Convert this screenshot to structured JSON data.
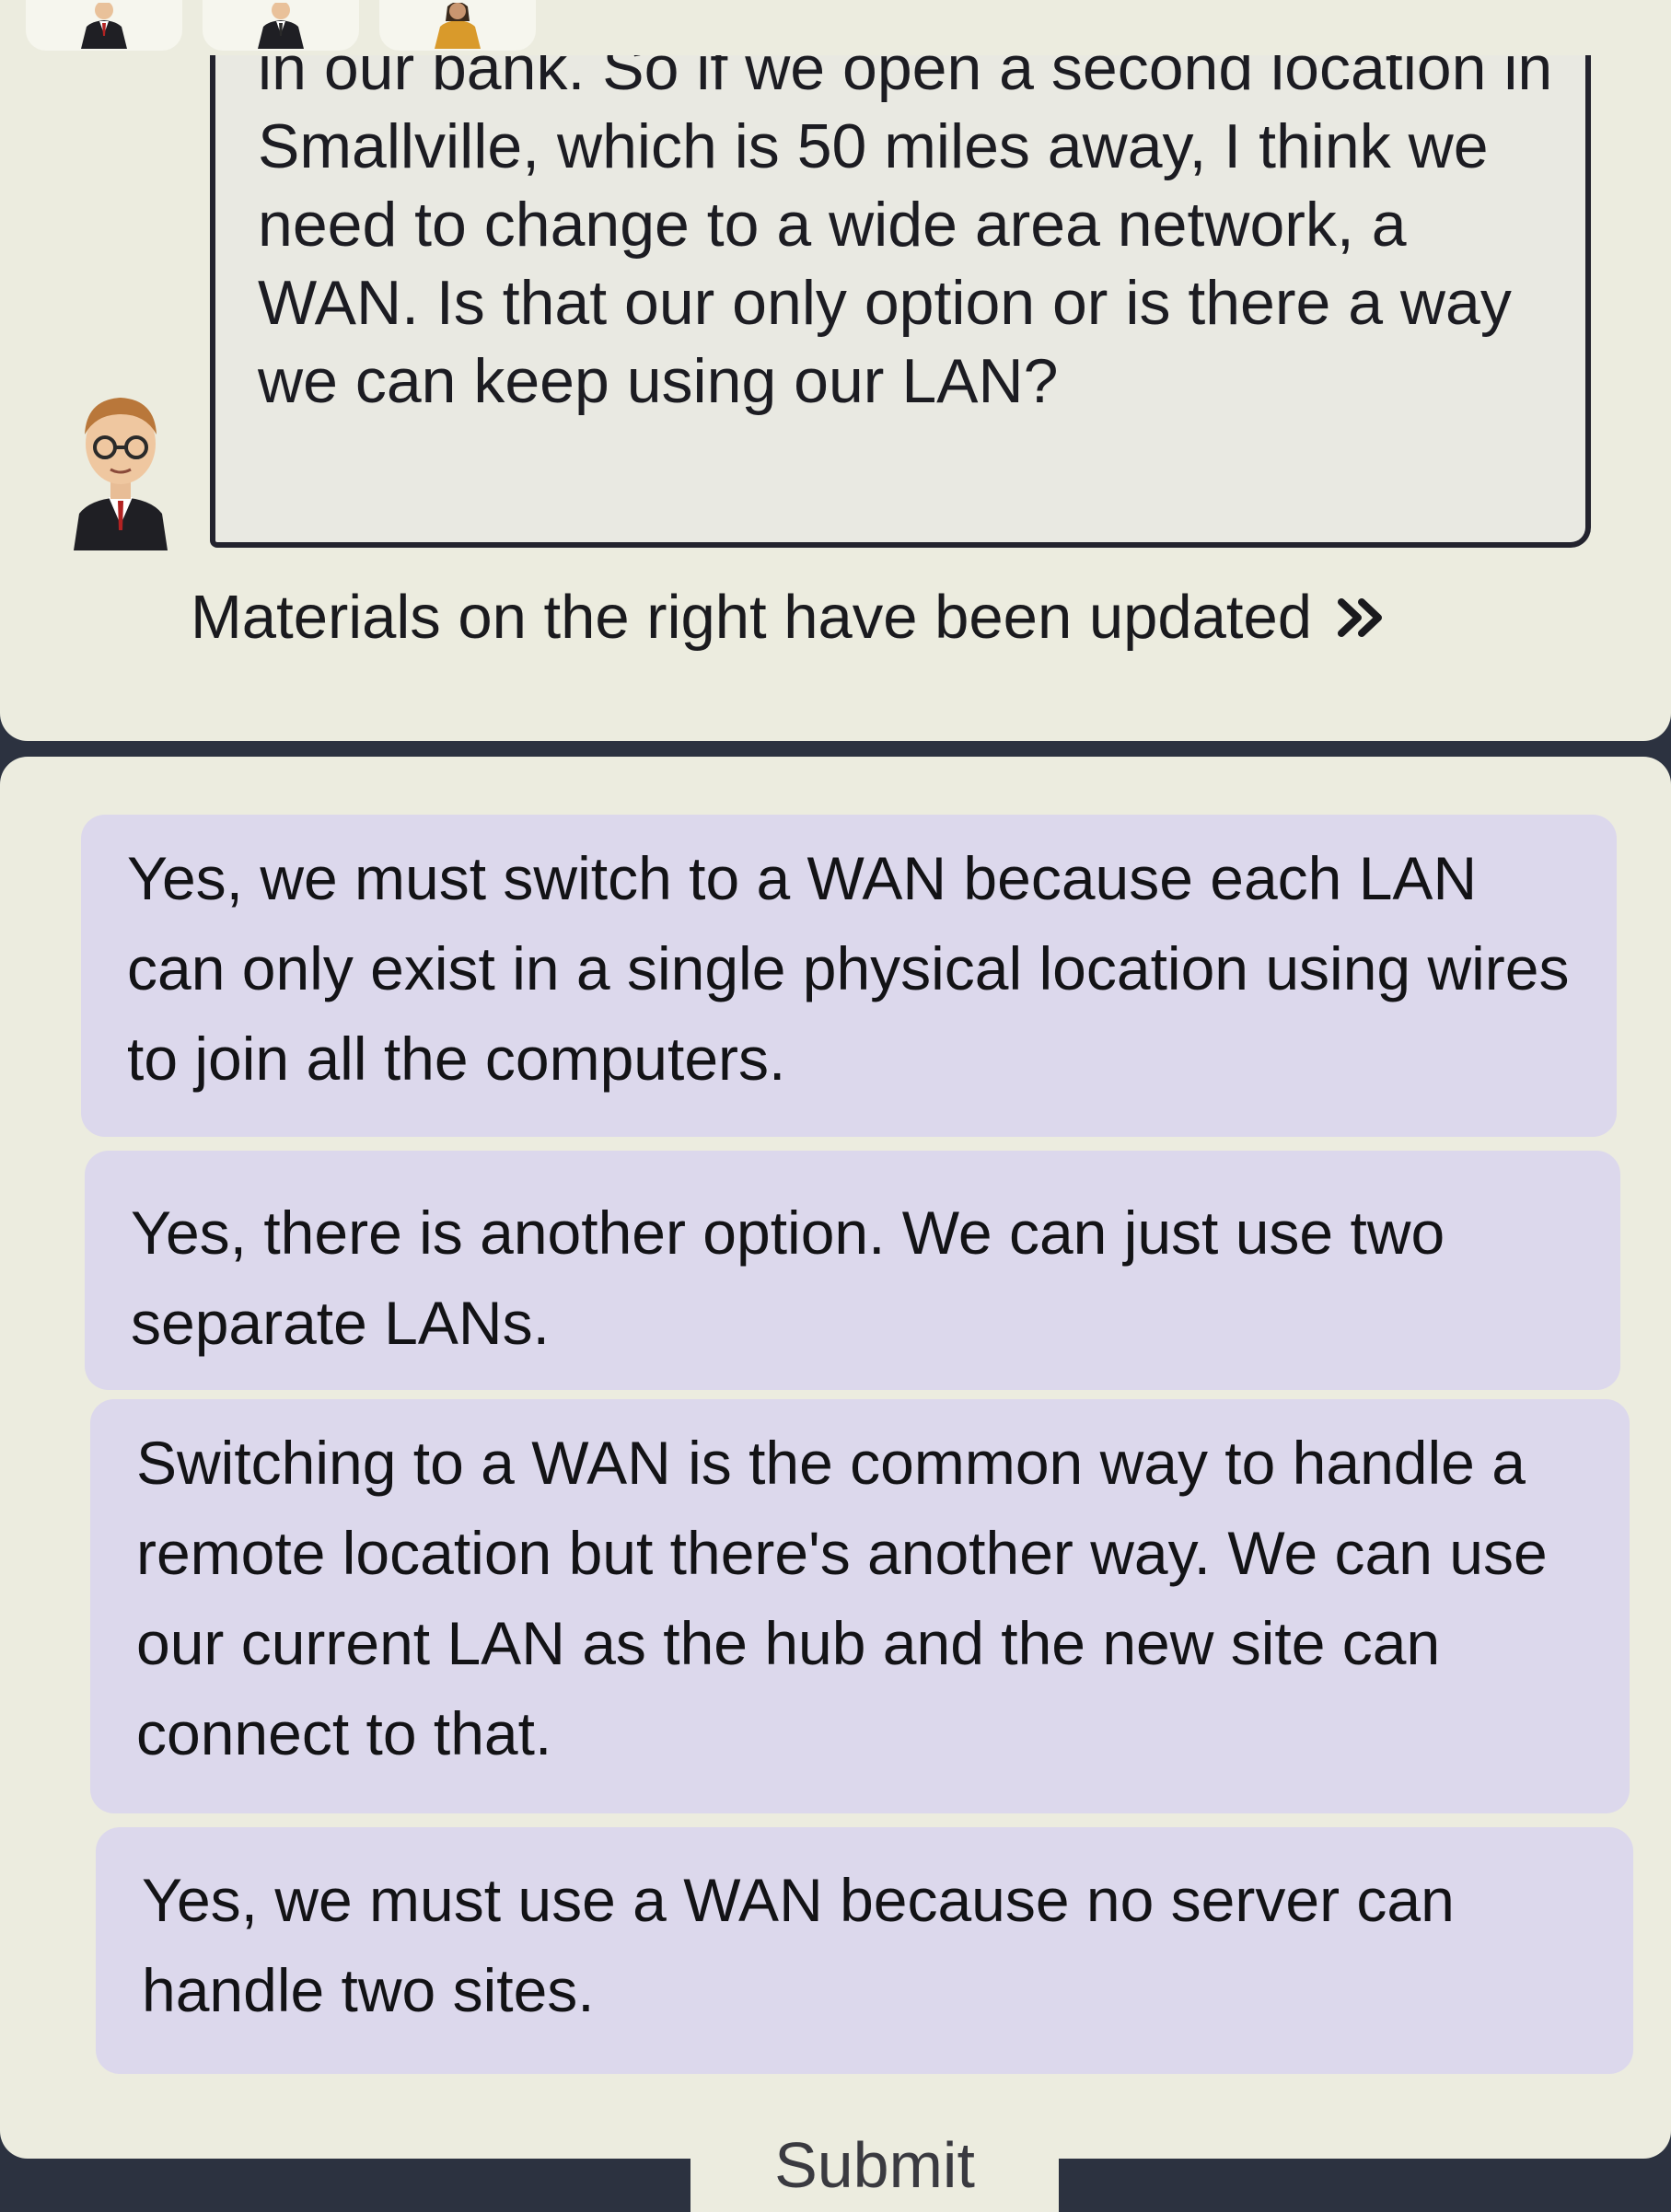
{
  "header": {
    "avatar_tabs": [
      {
        "icon": "businessman-avatar-icon"
      },
      {
        "icon": "businessman-avatar-icon"
      },
      {
        "icon": "businesswoman-avatar-icon"
      }
    ]
  },
  "conversation": {
    "speaker_icon": "man-with-glasses-avatar-icon",
    "message": "in our bank. So if we open a second location in Smallville, which is 50 miles away, I think we need to change to a wide area network, a WAN. Is that our only option or is there a way we can keep using our LAN?",
    "materials_note": "Materials on the right have been updated",
    "materials_icon": "double-chevron-right-icon"
  },
  "answers": [
    {
      "label": "Yes, we must switch to a WAN because each LAN can only exist in a single physical location using wires to join all the computers."
    },
    {
      "label": "Yes, there is another option. We can just use two separate LANs."
    },
    {
      "label": "Switching to a WAN is the common way to handle a remote location but there's another way. We can use our current LAN as the hub and the new site can connect to that."
    },
    {
      "label": "Yes, we must use a WAN because no server can handle two sites."
    }
  ],
  "submit_label": "Submit",
  "colors": {
    "panel_background": "#ececdf",
    "answer_background": "#dcd8ec",
    "page_background": "#2c3240",
    "bubble_border": "#23232e"
  }
}
